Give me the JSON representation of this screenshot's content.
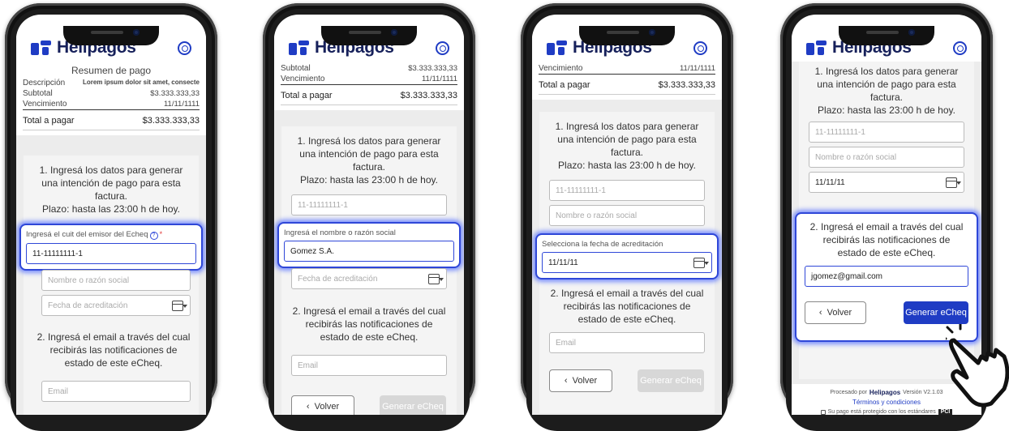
{
  "brand": {
    "name": "Helipagos",
    "accent": "#1f3cc4",
    "focus_glow": "#2f47d8"
  },
  "icons": {
    "whatsapp": "whatsapp-icon",
    "calendar": "calendar-icon",
    "help": "help-circle-icon",
    "hand": "pointing-hand-icon"
  },
  "summary": {
    "title": "Resumen de pago",
    "description_label": "Descripción",
    "description_value": "Lorem ipsum dolor sit amet, consecte",
    "subtotal_label": "Subtotal",
    "subtotal_value": "$3.333.333,33",
    "due_label": "Vencimiento",
    "due_value": "11/11/1111",
    "total_label": "Total a pagar",
    "total_value": "$3.333.333,33"
  },
  "step1": {
    "line1": "1. Ingresá los datos para generar",
    "line2": "una intención de pago para esta",
    "line3": "factura.",
    "line4": "Plazo: hasta las 23:00 h de hoy."
  },
  "step2": {
    "line1": "2. Ingresá el email a través del cual",
    "line2": "recibirás las notificaciones de",
    "line3": "estado de este eCheq."
  },
  "fields": {
    "cuit_label": "Ingresá el cuit del emisor del Echeq",
    "cuit_value": "11-11111111-1",
    "name_label": "Ingresá el nombre o razón social",
    "name_placeholder": "Nombre o razón social",
    "name_value": "Gomez S.A.",
    "date_label": "Selecciona la fecha de acreditación",
    "date_placeholder": "Fecha de acreditación",
    "date_value": "11/11/11",
    "email_placeholder": "Email",
    "email_value": "jgomez@gmail.com",
    "help_glyph": "?",
    "required_glyph": "*"
  },
  "buttons": {
    "back": "Volver",
    "generate": "Generar eCheq"
  },
  "footer": {
    "processed_by": "Procesado por",
    "version": "Versión V2.1.03",
    "terms": "Términos y condiciones",
    "secure": "Su pago está protegido con los estándares",
    "pci": "PCI"
  }
}
